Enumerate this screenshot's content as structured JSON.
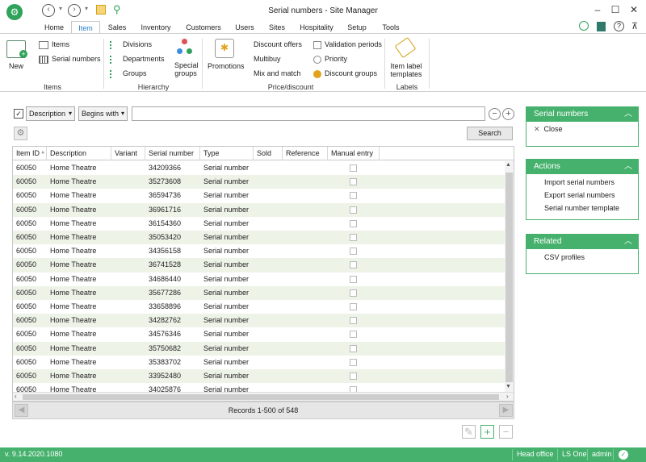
{
  "window": {
    "title": "Serial numbers - Site Manager"
  },
  "tabs": [
    "Home",
    "Item",
    "Sales",
    "Inventory",
    "Customers",
    "Users",
    "Sites",
    "Hospitality",
    "Setup",
    "Tools"
  ],
  "ribbon": {
    "new_label": "New",
    "items_group": {
      "items": "Items",
      "serial_numbers": "Serial numbers",
      "label": "Items"
    },
    "hierarchy_group": {
      "divisions": "Divisions",
      "departments": "Departments",
      "groups": "Groups",
      "special_groups_1": "Special",
      "special_groups_2": "groups",
      "label": "Hierarchy"
    },
    "price_group": {
      "promotions": "Promotions",
      "discount_offers": "Discount offers",
      "multibuy": "Multibuy",
      "mix_and_match": "Mix and match",
      "validation_periods": "Validation periods",
      "priority": "Priority",
      "discount_groups": "Discount groups",
      "label": "Price/discount"
    },
    "labels_group": {
      "item_label_1": "Item label",
      "item_label_2": "templates",
      "label": "Labels"
    }
  },
  "filter": {
    "field": "Description",
    "operator": "Begins with",
    "value": "",
    "search_label": "Search"
  },
  "grid": {
    "columns": [
      "Item ID",
      "Description",
      "Variant",
      "Serial number",
      "Type",
      "Sold",
      "Reference",
      "Manual entry"
    ],
    "rows": [
      [
        "60050",
        "Home Theatre",
        "",
        "34209366",
        "Serial number"
      ],
      [
        "60050",
        "Home Theatre",
        "",
        "35273608",
        "Serial number"
      ],
      [
        "60050",
        "Home Theatre",
        "",
        "36594736",
        "Serial number"
      ],
      [
        "60050",
        "Home Theatre",
        "",
        "36961716",
        "Serial number"
      ],
      [
        "60050",
        "Home Theatre",
        "",
        "36154360",
        "Serial number"
      ],
      [
        "60050",
        "Home Theatre",
        "",
        "35053420",
        "Serial number"
      ],
      [
        "60050",
        "Home Theatre",
        "",
        "34356158",
        "Serial number"
      ],
      [
        "60050",
        "Home Theatre",
        "",
        "36741528",
        "Serial number"
      ],
      [
        "60050",
        "Home Theatre",
        "",
        "34686440",
        "Serial number"
      ],
      [
        "60050",
        "Home Theatre",
        "",
        "35677286",
        "Serial number"
      ],
      [
        "60050",
        "Home Theatre",
        "",
        "33658896",
        "Serial number"
      ],
      [
        "60050",
        "Home Theatre",
        "",
        "34282762",
        "Serial number"
      ],
      [
        "60050",
        "Home Theatre",
        "",
        "34576346",
        "Serial number"
      ],
      [
        "60050",
        "Home Theatre",
        "",
        "35750682",
        "Serial number"
      ],
      [
        "60050",
        "Home Theatre",
        "",
        "35383702",
        "Serial number"
      ],
      [
        "60050",
        "Home Theatre",
        "",
        "33952480",
        "Serial number"
      ],
      [
        "60050",
        "Home Theatre",
        "",
        "34025876",
        "Serial number"
      ]
    ],
    "records_text": "Records 1-500 of 548"
  },
  "side": {
    "serial_numbers": {
      "title": "Serial numbers",
      "close": "Close"
    },
    "actions": {
      "title": "Actions",
      "items": [
        "Import serial numbers",
        "Export serial numbers",
        "Serial number template"
      ]
    },
    "related": {
      "title": "Related",
      "items": [
        "CSV profiles"
      ]
    }
  },
  "status": {
    "version": "v. 9.14.2020.1080",
    "location": "Head office",
    "product": "LS One",
    "user": "admin"
  },
  "colors": {
    "accent_green": "#46b16d",
    "tab_blue": "#2a7cc7",
    "row_alt": "#eef3e8"
  }
}
